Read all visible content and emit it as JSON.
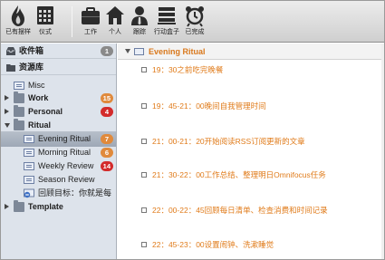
{
  "toolbar": {
    "buttons": [
      {
        "label": "已有摆样",
        "icon": "flame-icon"
      },
      {
        "label": "仪式",
        "icon": "calendar-grid-icon"
      },
      {
        "label": "工作",
        "icon": "briefcase-icon"
      },
      {
        "label": "个人",
        "icon": "home-icon"
      },
      {
        "label": "跟踪",
        "icon": "person-icon"
      },
      {
        "label": "行动盒子",
        "icon": "inbox-stack-icon"
      },
      {
        "label": "已完成",
        "icon": "alarm-clock-icon"
      }
    ]
  },
  "sidebar": {
    "inbox": {
      "label": "收件箱",
      "count": "1"
    },
    "library": {
      "label": "资源库"
    },
    "items": [
      {
        "label": "Misc"
      },
      {
        "label": "Work",
        "count": "15"
      },
      {
        "label": "Personal",
        "count": "4"
      },
      {
        "label": "Ritual"
      },
      {
        "label": "Evening Ritual",
        "count": "7"
      },
      {
        "label": "Morning Ritual",
        "count": "6"
      },
      {
        "label": "Weekly Review",
        "count": "14"
      },
      {
        "label": "Season Review"
      },
      {
        "label": "回顾目标：你就是每"
      },
      {
        "label": "Template"
      }
    ]
  },
  "colors": {
    "badge_gray": "#8a8a8a",
    "badge_orange": "#e08a3c",
    "badge_red": "#d32b2b",
    "accent_orange": "#e07b1a"
  },
  "main": {
    "header": "Evening Ritual",
    "actions": [
      "19：30之前吃完晚餐",
      "19：45-21：00晚间自我管理时间",
      "21：00-21：20开始阅读RSS订阅更新的文章",
      "21：30-22：00工作总结、整理明日Omnifocus任务",
      "22：00-22：45回顾每日清单、检查消费和时间记录",
      "22：45-23：00设置闹钟、洗漱睡觉"
    ]
  }
}
